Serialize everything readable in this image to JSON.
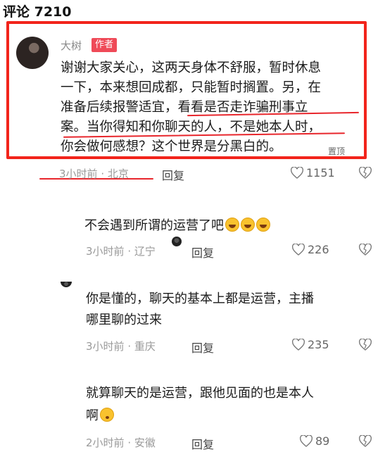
{
  "header": {
    "title": "评论 7210"
  },
  "pinned_comment": {
    "username": "大树",
    "badge": "作者",
    "lines": [
      "谢谢大家关心，这两天身体不舒服，暂时休息",
      "一下，本来想回成都，只能暂时搁置。另，在",
      "准备后续报警适宜，看看是否走诈骗刑事立",
      "案。当你得知和你聊天的人，不是她本人时，",
      "你会做何感想？这个世界是分黑白的。"
    ],
    "pin_tag": "置顶",
    "time": "3小时前",
    "location": "北京",
    "reply_label": "回复",
    "likes": "1151"
  },
  "replies": [
    {
      "lines": [
        "不会遇到所谓的运营了吧"
      ],
      "emoji": "laughing-crying-emoji",
      "time": "3小时前",
      "location": "辽宁",
      "reply_label": "回复",
      "likes": "226"
    },
    {
      "lines": [
        "你是懂的，聊天的基本上都是运营，主播",
        "哪里聊的过来"
      ],
      "time": "3小时前",
      "location": "重庆",
      "reply_label": "回复",
      "likes": "235"
    },
    {
      "lines": [
        "就算聊天的是运营，跟他见面的也是本人",
        "啊"
      ],
      "emoji": "flushed-emoji",
      "time": "2小时前",
      "location": "安徽",
      "reply_label": "回复",
      "likes": "89"
    }
  ],
  "colors": {
    "highlight_red": "#f2241b",
    "badge_pink": "#ef4a58",
    "meta_gray": "#9a9a9a"
  }
}
